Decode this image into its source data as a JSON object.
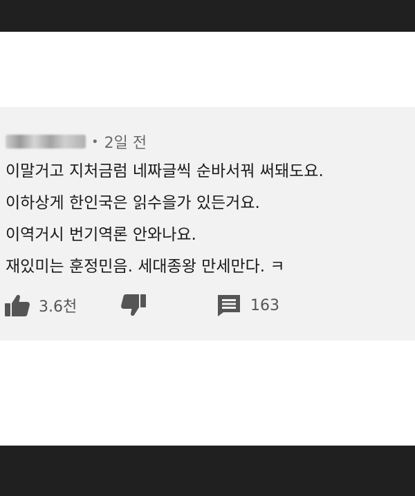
{
  "comment": {
    "time": "2일 전",
    "separator": "•",
    "lines": [
      "이말거고 지처금럼 네짜글씩 순바서꿔 써돼도요.",
      "이하상게 한인국은 읽수을가 있든거요.",
      "이역거시 번기역론 안와나요.",
      "재있미는 훈정민음. 세대종왕 만세만다. ㅋ"
    ]
  },
  "actions": {
    "like": {
      "icon": "thumbs-up-icon",
      "count": "3.6천"
    },
    "dislike": {
      "icon": "thumbs-down-icon"
    },
    "reply": {
      "icon": "comment-icon",
      "count": "163"
    }
  },
  "colors": {
    "frame_bar": "#202020",
    "card_background": "#f2f2f2",
    "text": "#1a1a1a",
    "icon": "#555555"
  }
}
